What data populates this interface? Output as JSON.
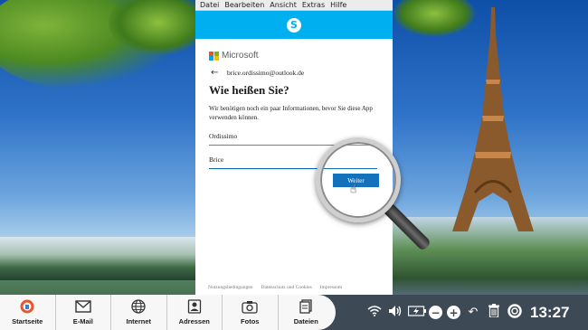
{
  "menubar": {
    "items": [
      "Datei",
      "Bearbeiten",
      "Ansicht",
      "Extras",
      "Hilfe"
    ]
  },
  "skype": {
    "logo": "S"
  },
  "signup": {
    "brand": "Microsoft",
    "account_email": "brice.ordissimo@outlook.de",
    "title": "Wie heißen Sie?",
    "description": "Wir benötigen noch ein paar Informationen, bevor Sie diese App verwenden können.",
    "last_name_value": "Ordissimo",
    "first_name_value": "Brice",
    "next_label": "Weiter",
    "footer_links": [
      "Nutzungsbedingungen",
      "Datenschutz und Cookies",
      "Impressum"
    ]
  },
  "dock": {
    "items": [
      {
        "label": "Startseite",
        "icon": "home-icon"
      },
      {
        "label": "E-Mail",
        "icon": "mail-icon"
      },
      {
        "label": "Internet",
        "icon": "globe-icon"
      },
      {
        "label": "Adressen",
        "icon": "contacts-icon"
      },
      {
        "label": "Fotos",
        "icon": "camera-icon"
      },
      {
        "label": "Dateien",
        "icon": "files-icon"
      }
    ]
  },
  "tray": {
    "clock": "13:27",
    "icons": [
      "wifi-icon",
      "volume-icon",
      "battery-icon",
      "zoom-out-icon",
      "zoom-in-icon",
      "undo-icon",
      "trash-icon",
      "help-icon"
    ]
  },
  "colors": {
    "skype_blue": "#00aff0",
    "ms_button": "#0067b8",
    "taskbar": "#3d4955"
  }
}
